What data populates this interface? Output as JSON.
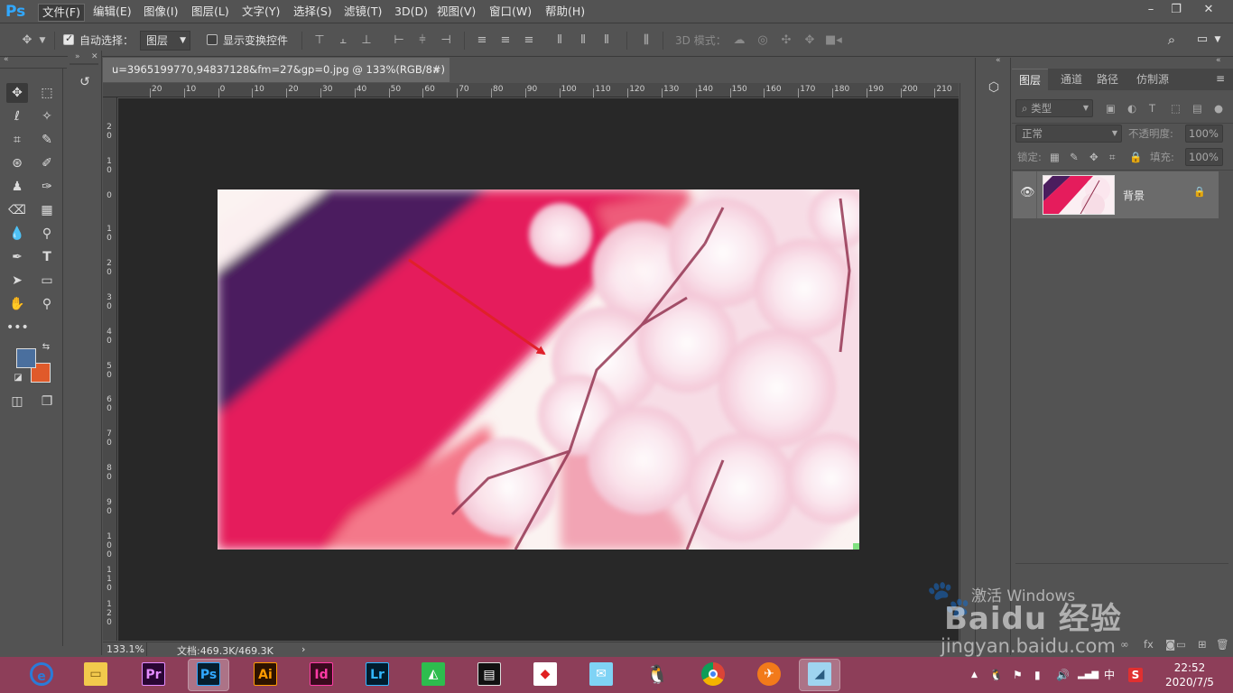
{
  "app": {
    "logo": "Ps",
    "menu": [
      "文件(F)",
      "编辑(E)",
      "图像(I)",
      "图层(L)",
      "文字(Y)",
      "选择(S)",
      "滤镜(T)",
      "3D(D)",
      "视图(V)",
      "窗口(W)",
      "帮助(H)"
    ],
    "active_menu_index": 0
  },
  "options": {
    "auto_select_label": "自动选择：",
    "auto_select_value": "图层",
    "show_transform_label": "显示变换控件",
    "mode_3d_label": "3D 模式："
  },
  "document": {
    "tab_title": "u=3965199770,94837128&fm=27&gp=0.jpg @ 133%(RGB/8#)",
    "tab_close": "×",
    "zoom": "133.1%",
    "doc_info": "文档:469.3K/469.3K",
    "ruler_h": [
      "20",
      "10",
      "0",
      "10",
      "20",
      "30",
      "40",
      "50",
      "60",
      "70",
      "80",
      "90",
      "100",
      "110",
      "120",
      "130",
      "140",
      "150",
      "160",
      "170",
      "180",
      "190",
      "200",
      "210"
    ],
    "ruler_v": [
      "2\n0",
      "1\n0",
      "0",
      "1\n0",
      "2\n0",
      "3\n0",
      "4\n0",
      "5\n0",
      "6\n0",
      "7\n0",
      "8\n0",
      "9\n0",
      "1\n0\n0",
      "1\n1\n0",
      "1\n2\n0"
    ]
  },
  "layers_panel": {
    "tabs": [
      "图层",
      "通道",
      "路径",
      "仿制源"
    ],
    "filter_label": "类型",
    "blend_mode": "正常",
    "opacity_label": "不透明度:",
    "opacity_value": "100%",
    "lock_label": "锁定:",
    "fill_label": "填充:",
    "fill_value": "100%",
    "layers": [
      {
        "name": "背景",
        "visible": true,
        "locked": true
      }
    ]
  },
  "taskbar": {
    "apps": [
      "edge",
      "file-explorer",
      "Pr",
      "Ps",
      "Ai",
      "Id",
      "Lr",
      "app-green",
      "video-editor",
      "app-shield",
      "app-bird",
      "qq",
      "chrome",
      "app-phoenix",
      "app-notes"
    ],
    "active_app_index": 3,
    "ime": "中",
    "time": "22:52",
    "date": "2020/7/5"
  },
  "watermark": {
    "activate_text": "激活 Windows",
    "brand": "Baidu 经验",
    "site": "jingyan.baidu.com"
  },
  "colors": {
    "foreground": "#4a6f9e",
    "background": "#e05a2a",
    "arrow": "#e0202a",
    "ps_blue": "#31a8ff",
    "taskbar": "#8d3e59"
  }
}
